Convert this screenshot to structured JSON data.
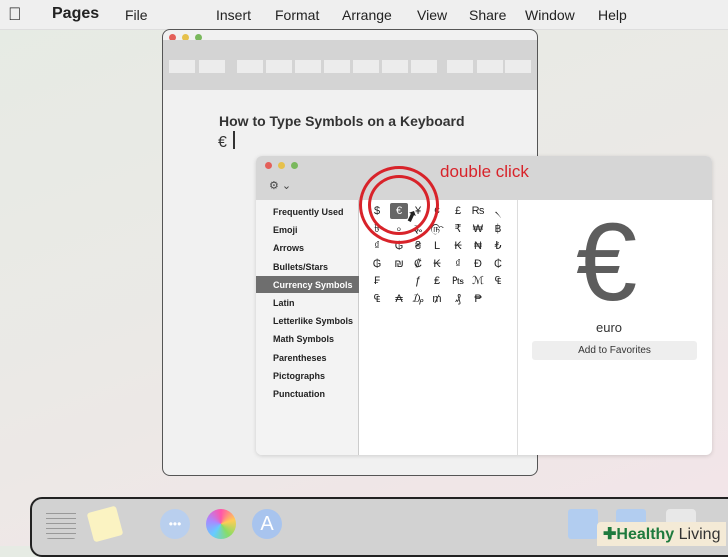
{
  "menubar": {
    "app": "Pages",
    "items": [
      "File",
      "Insert",
      "Format",
      "Arrange",
      "View",
      "Share",
      "Window",
      "Help"
    ]
  },
  "document": {
    "title": "How to Type Symbols on a Keyboard",
    "typed": "€"
  },
  "viewer": {
    "categories": [
      "Frequently Used",
      "Emoji",
      "Arrows",
      "Bullets/Stars",
      "Currency Symbols",
      "Latin",
      "Letterlike Symbols",
      "Math Symbols",
      "Parentheses",
      "Pictographs",
      "Punctuation"
    ],
    "selected_category": "Currency Symbols",
    "symbols": [
      [
        "$",
        "€",
        "¥",
        "¢",
        "£",
        "₨",
        "৲"
      ],
      [
        "৳",
        "৹",
        "૱",
        "௹",
        "₹",
        "₩",
        "฿"
      ],
      [
        "₫",
        "₲",
        "₴",
        "L",
        "₭",
        "₦",
        "₺"
      ],
      [
        "₲",
        "₪",
        "₡",
        "₭",
        "₫",
        "Đ",
        "₵"
      ],
      [
        "₣",
        "",
        "ƒ",
        "₤",
        "₧",
        "ℳ",
        "₠"
      ],
      [
        "₠",
        "₳",
        "₯",
        "₥",
        "₰",
        "₱",
        ""
      ]
    ],
    "selected_symbol": "€",
    "detail_glyph": "€",
    "detail_name": "euro",
    "add_favorites": "Add to Favorites",
    "settings_icon": "⚙ ⌄"
  },
  "annotation": {
    "label": "double click",
    "color": "#d8232a"
  },
  "watermark": {
    "brand": "Healthy",
    "suffix": "Living"
  }
}
